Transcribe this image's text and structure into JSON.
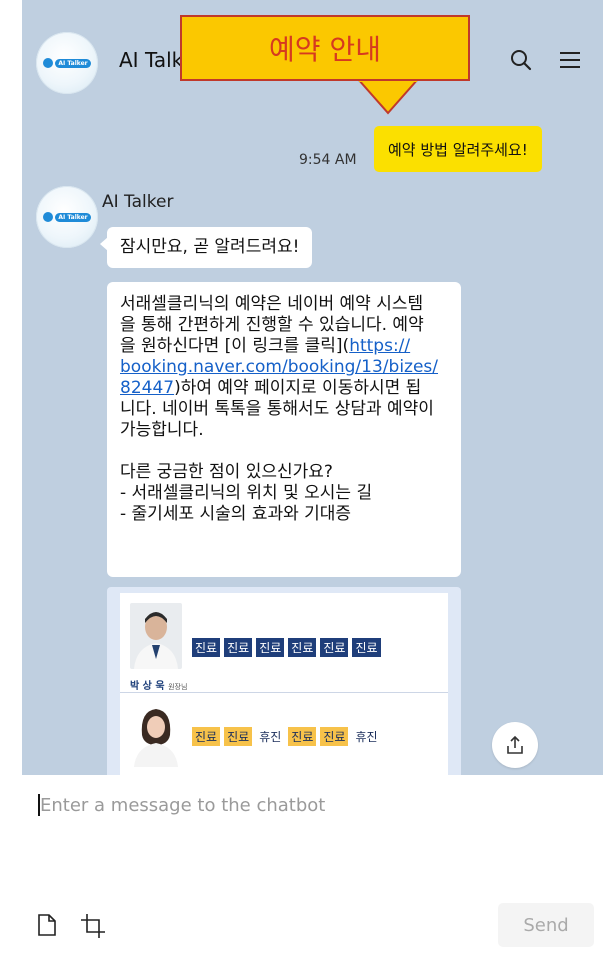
{
  "header": {
    "avatar_text": "AI Talker",
    "title": "AI Talk",
    "search_icon": "search-icon",
    "menu_icon": "hamburger-menu-icon"
  },
  "annotation": {
    "text": "예약 안내",
    "colors": {
      "fill": "#fbc800",
      "border": "#c0392b",
      "text": "#d63a1f"
    }
  },
  "conversation": {
    "user_message": "예약 방법 알려주세요!",
    "time": "9:54 AM",
    "bot_name": "AI Talker",
    "bot_short_reply": "잠시만요, 곧 알려드려요!",
    "bot_reply": {
      "line1": "서래셀클리닉의 예약은 네이버 예약 시스템",
      "line2": "을 통해 간편하게 진행할 수 있습니다. 예약",
      "line3_before_link": "을 원하신다면 [이 링크를 클릭](",
      "link_part1": "https://",
      "link_part2": "booking.naver.com/booking/13/bizes/",
      "link_part3": "82447",
      "line6_after_link": ")하여 예약 페이지로 이동하시면 됩",
      "line7": "니다. 네이버 톡톡을 통해서도 상담과 예약이",
      "line8": "가능합니다.",
      "line10": "다른 궁금한 점이 있으신가요?",
      "line11": "- 서래셀클리닉의 위치 및 오시는 길",
      "line12": "- 줄기세포 시술의 효과와 기대증"
    },
    "schedule": {
      "doctor1_name": "박 상 욱",
      "doctor1_title": "원장님",
      "doctor1_tags": [
        "진료",
        "진료",
        "진료",
        "진료",
        "진료",
        "진료"
      ],
      "doctor2_tags": [
        {
          "label": "진료",
          "style": "yellow"
        },
        {
          "label": "진료",
          "style": "yellow"
        },
        {
          "label": "휴진",
          "style": "off"
        },
        {
          "label": "진료",
          "style": "yellow"
        },
        {
          "label": "진료",
          "style": "yellow"
        },
        {
          "label": "휴진",
          "style": "off"
        }
      ]
    }
  },
  "composer": {
    "placeholder": "Enter a message to the chatbot",
    "send_label": "Send",
    "file_icon": "file-icon",
    "crop_icon": "crop-icon",
    "share_icon": "share-icon"
  },
  "colors": {
    "chat_background": "#bfcfe0",
    "user_bubble": "#fbe000",
    "bot_bubble": "#ffffff",
    "link": "#1560c8"
  }
}
